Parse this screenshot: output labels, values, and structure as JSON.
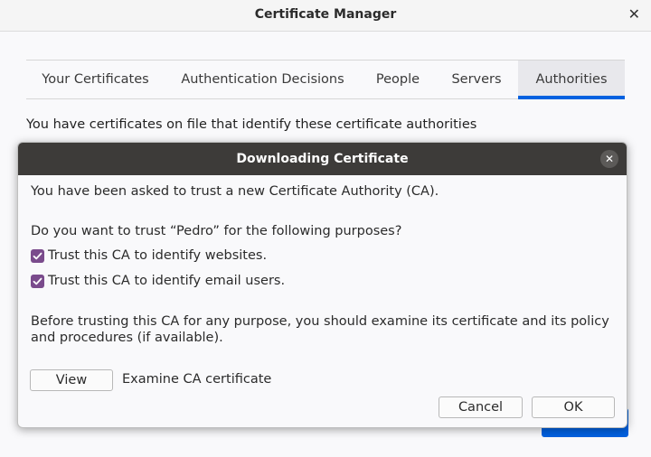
{
  "window": {
    "title": "Certificate Manager",
    "close_glyph": "✕"
  },
  "tabs": [
    {
      "label": "Your Certificates",
      "selected": false
    },
    {
      "label": "Authentication Decisions",
      "selected": false
    },
    {
      "label": "People",
      "selected": false
    },
    {
      "label": "Servers",
      "selected": false
    },
    {
      "label": "Authorities",
      "selected": true
    }
  ],
  "main": {
    "description": "You have certificates on file that identify these certificate authorities",
    "accent_color": "#0061e0"
  },
  "dialog": {
    "title": "Downloading Certificate",
    "close_glyph": "✕",
    "intro": "You have been asked to trust a new Certificate Authority (CA).",
    "question": "Do you want to trust “Pedro” for the following purposes?",
    "options": [
      {
        "label": "Trust this CA to identify websites.",
        "checked": true
      },
      {
        "label": "Trust this CA to identify email users.",
        "checked": true
      }
    ],
    "warning": "Before trusting this CA for any purpose, you should examine its certificate and its policy and procedures (if available).",
    "view_button": "View",
    "view_caption": "Examine CA certificate",
    "cancel_button": "Cancel",
    "ok_button": "OK",
    "checkbox_color": "#7a4b8c",
    "header_color": "#3d3b39"
  }
}
